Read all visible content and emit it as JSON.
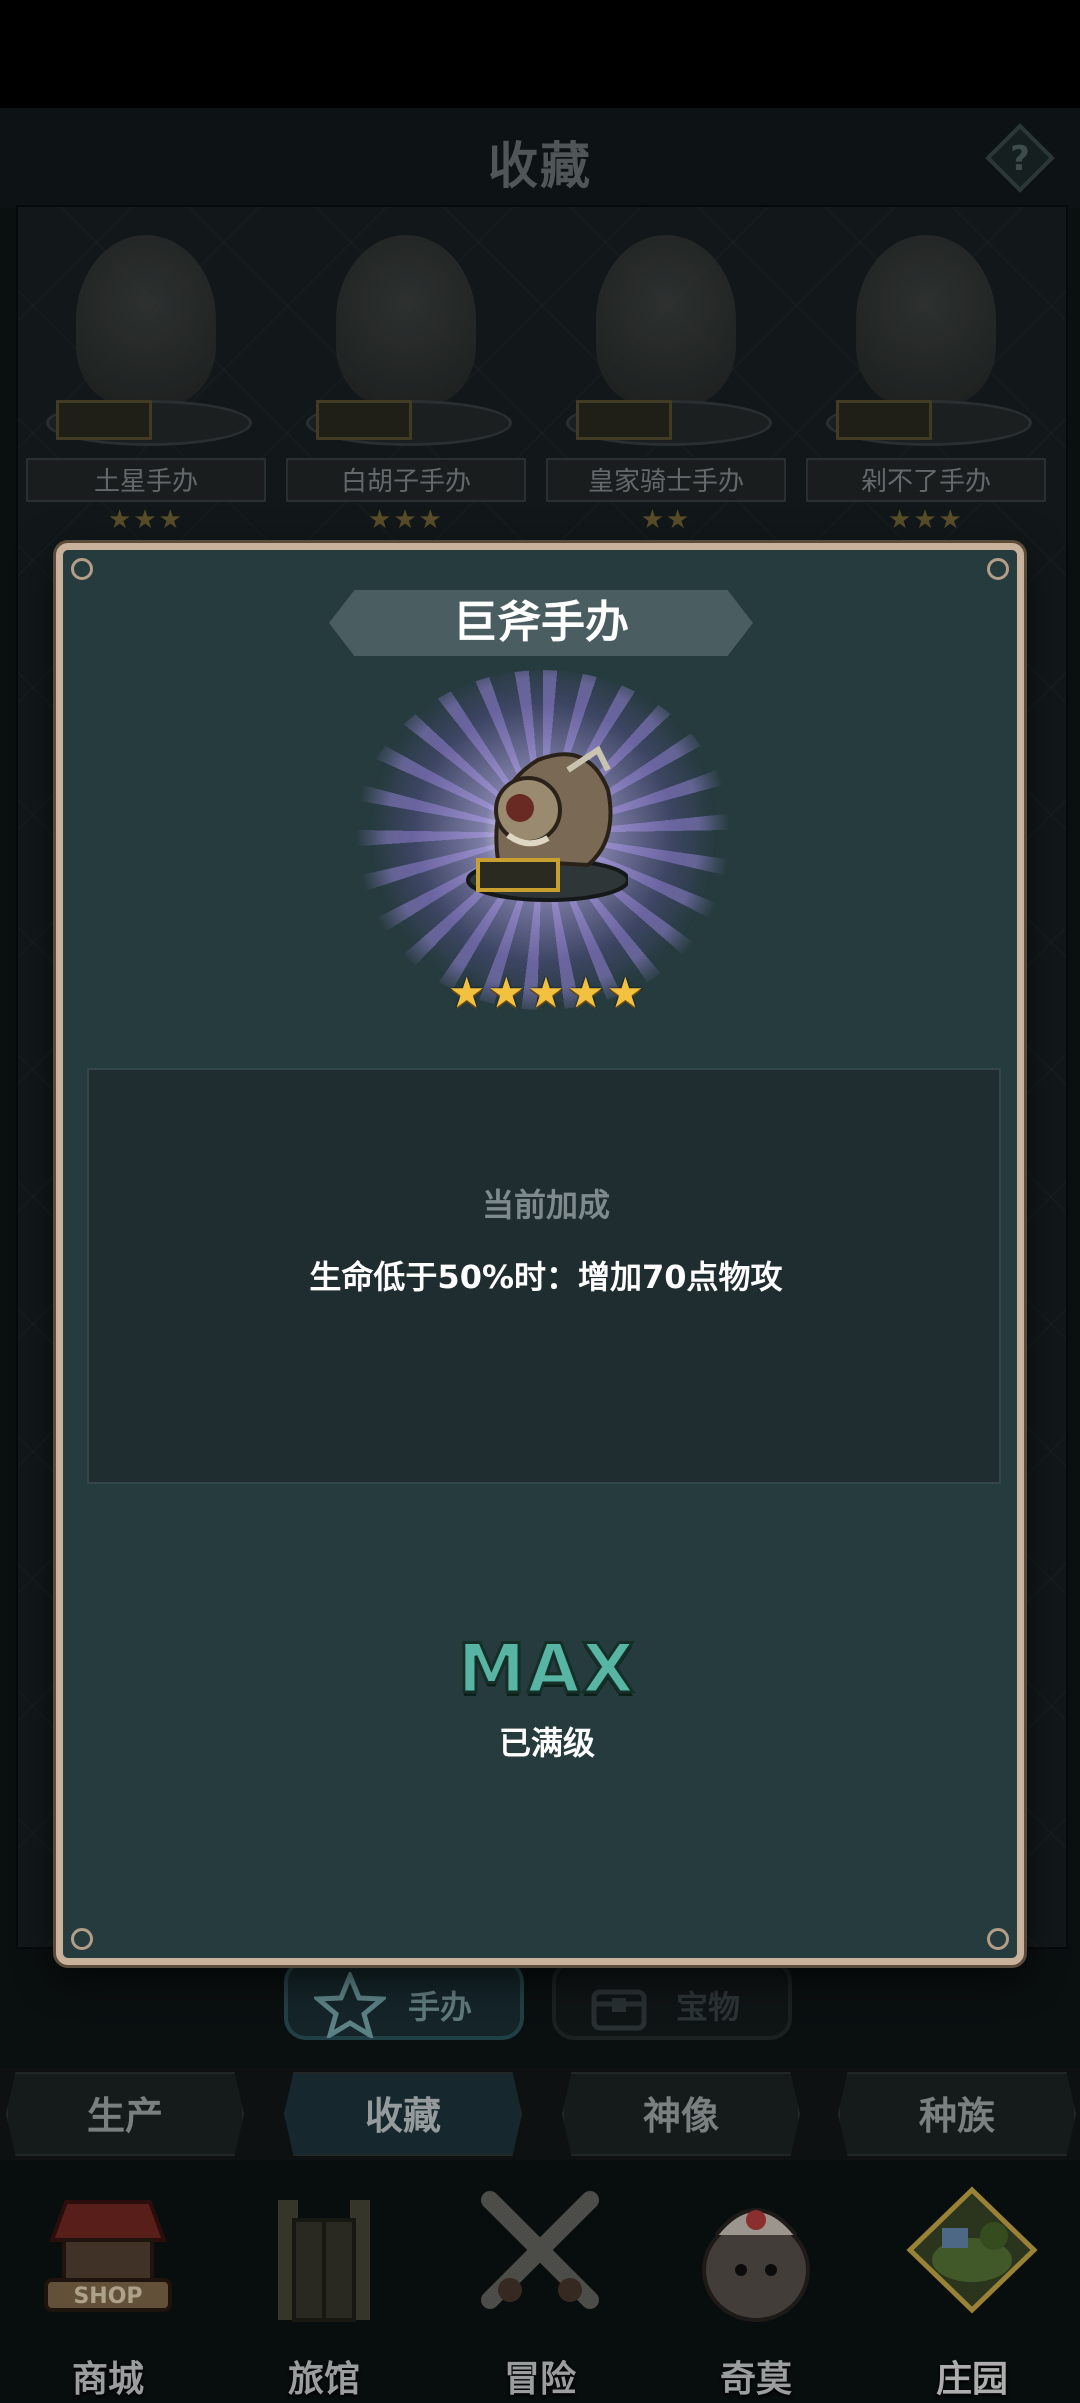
{
  "header": {
    "title": "收藏"
  },
  "collection": {
    "figures": [
      {
        "name": "土星手办",
        "stars": "★★★"
      },
      {
        "name": "白胡子手办",
        "stars": "★★★"
      },
      {
        "name": "皇家骑士手办",
        "stars": "★★"
      },
      {
        "name": "剁不了手办",
        "stars": "★★★"
      }
    ]
  },
  "modal": {
    "title": "巨斧手办",
    "stars": "★★★★★",
    "bonus_heading": "当前加成",
    "bonus_text": "生命低于50%时：增加70点物攻",
    "max_label": "MAX",
    "max_sub": "已满级"
  },
  "sub_tabs": [
    {
      "label": "手办",
      "active": true
    },
    {
      "label": "宝物",
      "active": false
    }
  ],
  "section_tabs": [
    {
      "label": "生产"
    },
    {
      "label": "收藏",
      "active": true
    },
    {
      "label": "神像"
    },
    {
      "label": "种族"
    }
  ],
  "bottom_nav": [
    {
      "label": "商城",
      "icon": "shop-icon",
      "badge": "SHOP"
    },
    {
      "label": "旅馆",
      "icon": "inn-icon"
    },
    {
      "label": "冒险",
      "icon": "crossed-swords-icon"
    },
    {
      "label": "奇莫",
      "icon": "qimo-character-icon"
    },
    {
      "label": "庄园",
      "icon": "manor-island-icon"
    }
  ],
  "colors": {
    "modal_bg": "#263b3e",
    "modal_border": "#c9b29b",
    "max_green": "#58b5a4",
    "star_gold": "#f3c140"
  }
}
